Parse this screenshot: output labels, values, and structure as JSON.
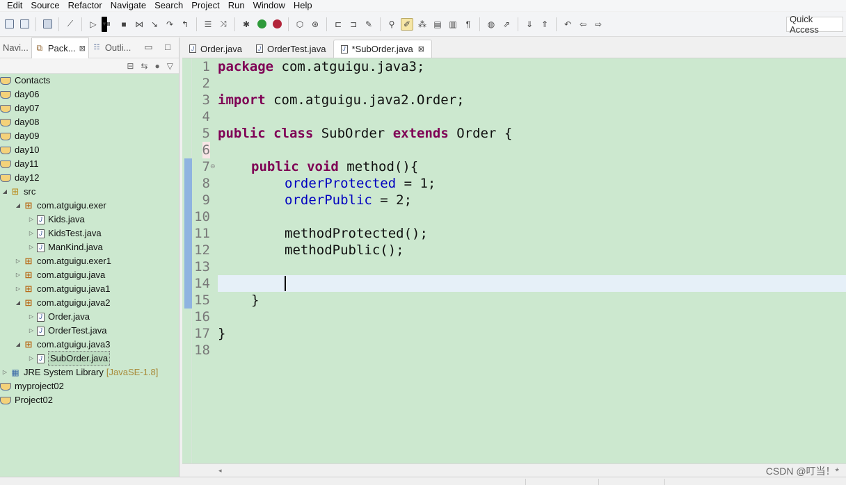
{
  "menu": [
    "Edit",
    "Source",
    "Refactor",
    "Navigate",
    "Search",
    "Project",
    "Run",
    "Window",
    "Help"
  ],
  "quick_access": "Quick Access",
  "left_tabs": [
    {
      "label": "Navi...",
      "close": ""
    },
    {
      "label": "Pack...",
      "close": "⊠"
    },
    {
      "label": "Outli...",
      "close": ""
    }
  ],
  "tree": [
    {
      "label": "Contacts",
      "kind": "proj"
    },
    {
      "label": "day06",
      "kind": "proj"
    },
    {
      "label": "day07",
      "kind": "proj"
    },
    {
      "label": "day08",
      "kind": "proj"
    },
    {
      "label": "day09",
      "kind": "proj"
    },
    {
      "label": "day10",
      "kind": "proj"
    },
    {
      "label": "day11",
      "kind": "proj"
    },
    {
      "label": "day12",
      "kind": "proj"
    },
    {
      "label": "src",
      "kind": "src"
    },
    {
      "label": "com.atguigu.exer",
      "kind": "pkg"
    },
    {
      "label": "Kids.java",
      "kind": "file"
    },
    {
      "label": "KidsTest.java",
      "kind": "file"
    },
    {
      "label": "ManKind.java",
      "kind": "file"
    },
    {
      "label": "com.atguigu.exer1",
      "kind": "pkg"
    },
    {
      "label": "com.atguigu.java",
      "kind": "pkg"
    },
    {
      "label": "com.atguigu.java1",
      "kind": "pkg"
    },
    {
      "label": "com.atguigu.java2",
      "kind": "pkg"
    },
    {
      "label": "Order.java",
      "kind": "file"
    },
    {
      "label": "OrderTest.java",
      "kind": "file"
    },
    {
      "label": "com.atguigu.java3",
      "kind": "pkg"
    },
    {
      "label": "SubOrder.java",
      "kind": "file"
    },
    {
      "label": "JRE System Library",
      "kind": "lib",
      "decoration": "[JavaSE-1.8]"
    },
    {
      "label": "myproject02",
      "kind": "proj"
    },
    {
      "label": "Project02",
      "kind": "proj"
    }
  ],
  "editor_tabs": [
    {
      "label": "Order.java"
    },
    {
      "label": "OrderTest.java"
    },
    {
      "label": "*SubOrder.java",
      "close": "⊠"
    }
  ],
  "line_numbers": [
    "1",
    "2",
    "3",
    "4",
    "5",
    "6",
    "7",
    "8",
    "9",
    "10",
    "11",
    "12",
    "13",
    "14",
    "15",
    "16",
    "17",
    "18"
  ],
  "code": {
    "l1_kw": "package",
    "l1_rest": " com.atguigu.java3;",
    "l3_kw": "import",
    "l3_rest": " com.atguigu.java2.Order;",
    "l5_kw1": "public",
    "l5_kw2": "class",
    "l5_name": " SubOrder ",
    "l5_kw3": "extends",
    "l5_rest": " Order {",
    "l7_kw1": "public",
    "l7_kw2": "void",
    "l7_rest": " method(){",
    "l8_fld": "orderProtected",
    "l8_rest": " = 1;",
    "l9_fld": "orderPublic",
    "l9_rest": " = 2;",
    "l11": "methodProtected();",
    "l12": "methodPublic();",
    "l15": "}",
    "l17": "}"
  },
  "watermark": "CSDN @叮当！*"
}
